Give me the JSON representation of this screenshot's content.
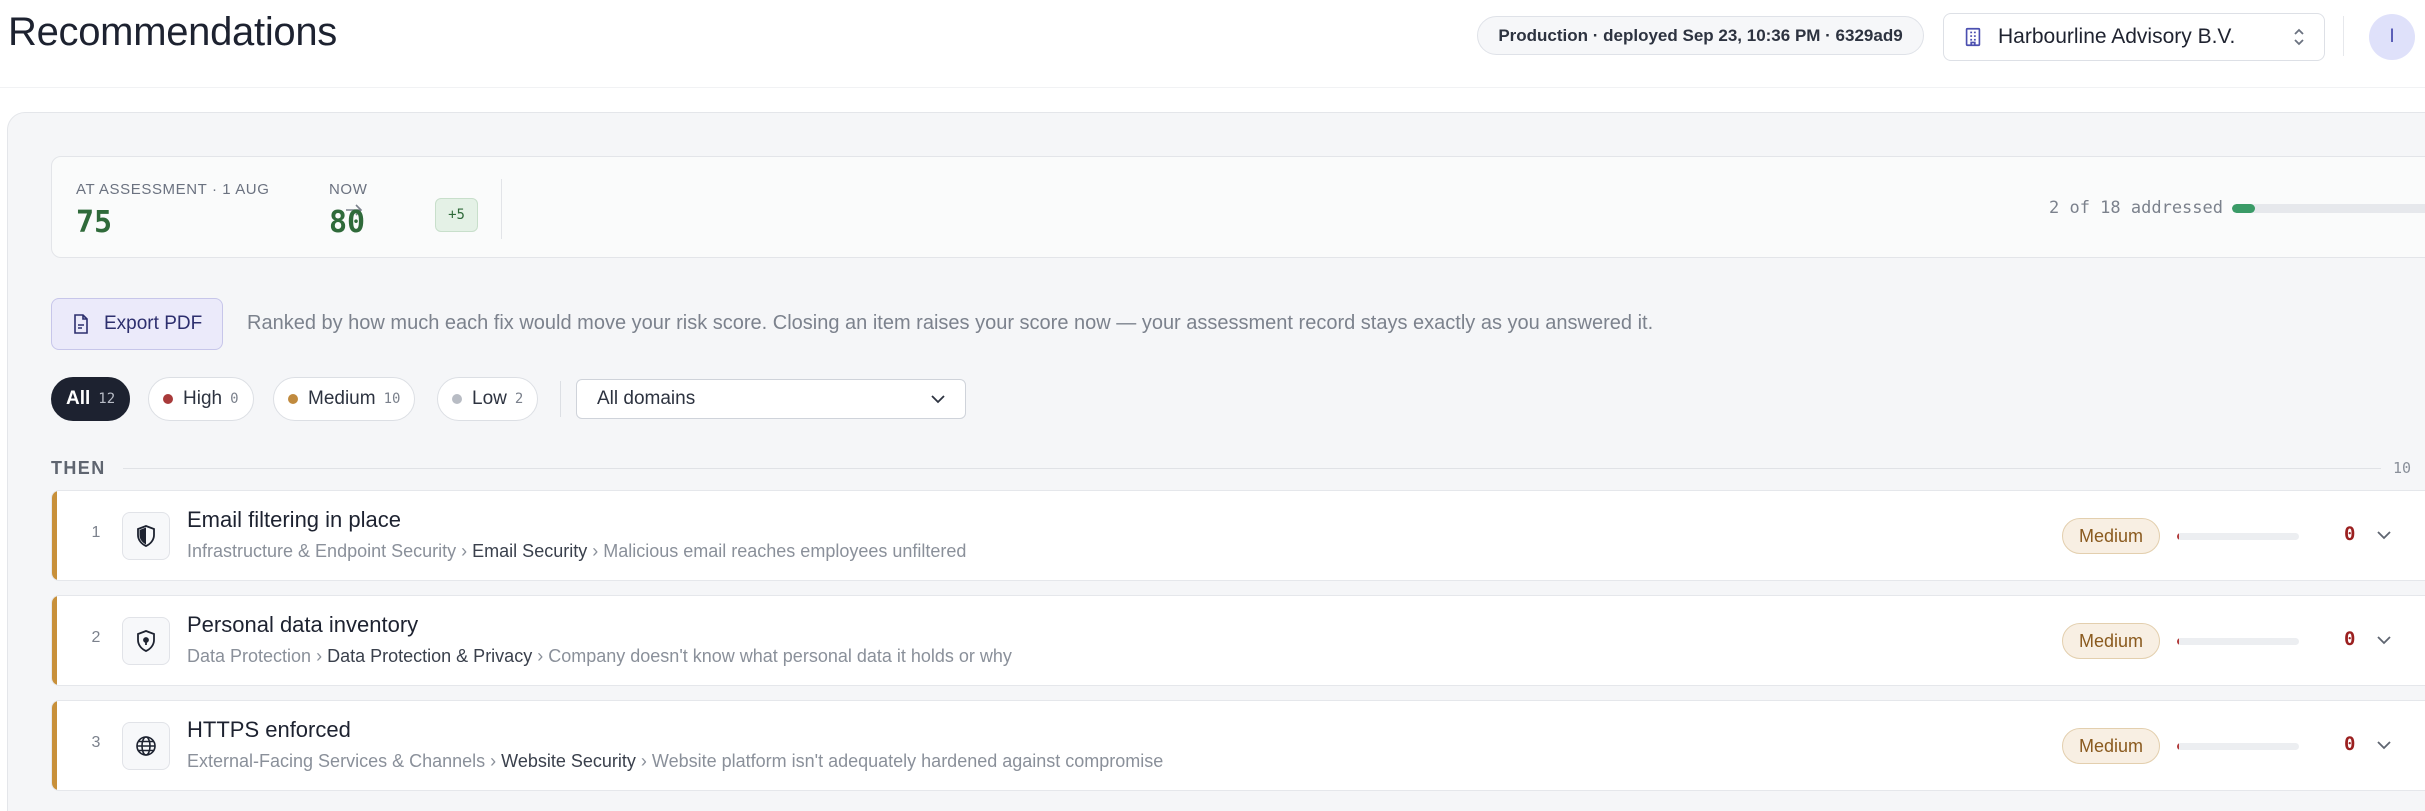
{
  "header": {
    "title": "Recommendations",
    "deploy_status": "Production · deployed Sep 23, 10:36 PM · 6329ad9",
    "org_name": "Harbourline Advisory B.V.",
    "avatar_initial": "I"
  },
  "score": {
    "assessment_label": "AT ASSESSMENT · 1 AUG",
    "assessment_value": "75",
    "now_label": "NOW",
    "now_value": "80",
    "delta": "+5",
    "addressed_text": "2 of 18 addressed",
    "addressed_fraction": 0.111
  },
  "actions": {
    "export_label": "Export PDF",
    "rank_description": "Ranked by how much each fix would move your risk score. Closing an item raises your score now — your assessment record stays exactly as you answered it."
  },
  "filters": {
    "chips": [
      {
        "label": "All",
        "count": "12",
        "active": true
      },
      {
        "label": "High",
        "count": "0",
        "color": "#a83a3a"
      },
      {
        "label": "Medium",
        "count": "10",
        "color": "#c08a3e"
      },
      {
        "label": "Low",
        "count": "2",
        "color": "#b8bcc4"
      }
    ],
    "domain_selected": "All domains"
  },
  "section": {
    "label": "THEN",
    "count": "10"
  },
  "recommendations": [
    {
      "num": "1",
      "title": "Email filtering in place",
      "domain": "Infrastructure & Endpoint Security",
      "subdomain": "Email Security",
      "issue": "Malicious email reaches employees unfiltered",
      "severity": "Medium",
      "score": "0",
      "icon": "shield-icon"
    },
    {
      "num": "2",
      "title": "Personal data inventory",
      "domain": "Data Protection",
      "subdomain": "Data Protection & Privacy",
      "issue": "Company doesn't know what personal data it holds or why",
      "severity": "Medium",
      "score": "0",
      "icon": "privacy-shield-icon"
    },
    {
      "num": "3",
      "title": "HTTPS enforced",
      "domain": "External-Facing Services & Channels",
      "subdomain": "Website Security",
      "issue": "Website platform isn't adequately hardened against compromise",
      "severity": "Medium",
      "score": "0",
      "icon": "globe-icon"
    }
  ],
  "separators": {
    "path_sep": "›",
    "arrow": "→"
  }
}
